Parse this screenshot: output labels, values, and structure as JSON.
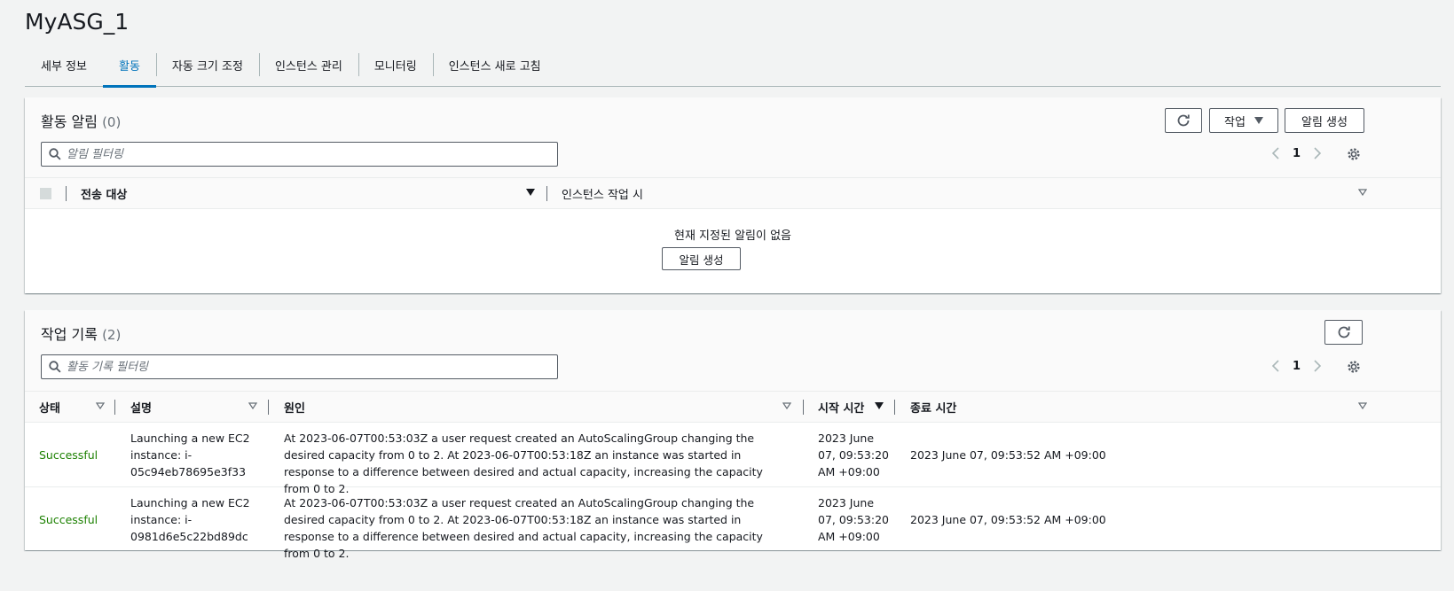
{
  "page": {
    "title": "MyASG_1"
  },
  "tabs": [
    {
      "label": "세부 정보"
    },
    {
      "label": "활동"
    },
    {
      "label": "자동 크기 조정"
    },
    {
      "label": "인스턴스 관리"
    },
    {
      "label": "모니터링"
    },
    {
      "label": "인스턴스 새로 고침"
    }
  ],
  "notifications": {
    "title": "활동 알림",
    "count": "(0)",
    "actions_label": "작업",
    "create_label": "알림 생성",
    "search_placeholder": "알림 필터링",
    "page": "1",
    "columns": {
      "target": "전송 대상",
      "when": "인스턴스 작업 시"
    },
    "empty_text": "현재 지정된 알림이 없음",
    "empty_button": "알림 생성"
  },
  "history": {
    "title": "작업 기록",
    "count": "(2)",
    "search_placeholder": "활동 기록 필터링",
    "page": "1",
    "columns": {
      "status": "상태",
      "description": "설명",
      "cause": "원인",
      "start": "시작 시간",
      "end": "종료 시간"
    },
    "rows": [
      {
        "status": "Successful",
        "description": "Launching a new EC2 instance: i-05c94eb78695e3f33",
        "cause": "At 2023-06-07T00:53:03Z a user request created an AutoScalingGroup changing the desired capacity from 0 to 2. At 2023-06-07T00:53:18Z an instance was started in response to a difference between desired and actual capacity, increasing the capacity from 0 to 2.",
        "start": "2023 June 07, 09:53:20 AM +09:00",
        "end": "2023 June 07, 09:53:52 AM +09:00"
      },
      {
        "status": "Successful",
        "description": "Launching a new EC2 instance: i-0981d6e5c22bd89dc",
        "cause": "At 2023-06-07T00:53:03Z a user request created an AutoScalingGroup changing the desired capacity from 0 to 2. At 2023-06-07T00:53:18Z an instance was started in response to a difference between desired and actual capacity, increasing the capacity from 0 to 2.",
        "start": "2023 June 07, 09:53:20 AM +09:00",
        "end": "2023 June 07, 09:53:52 AM +09:00"
      }
    ]
  },
  "colors": {
    "accent": "#0073bb",
    "success": "#1d8102",
    "border": "#545b64"
  }
}
